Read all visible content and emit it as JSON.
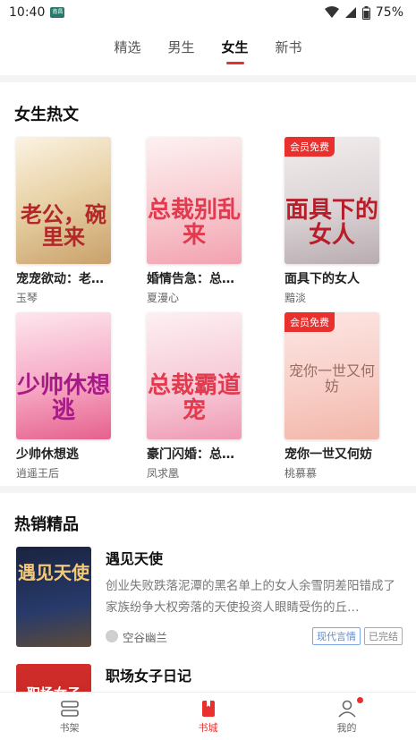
{
  "status": {
    "time": "10:40",
    "sim_label": "南昌",
    "battery": "75%"
  },
  "top_tabs": [
    {
      "label": "精选",
      "active": false
    },
    {
      "label": "男生",
      "active": false
    },
    {
      "label": "女生",
      "active": true
    },
    {
      "label": "新书",
      "active": false
    }
  ],
  "hot_section": {
    "title": "女生热文",
    "books": [
      {
        "cover_text": "老公，碗里来",
        "name": "宠宠欲动：老…",
        "author": "玉琴",
        "vip": ""
      },
      {
        "cover_text": "总裁别乱来",
        "name": "婚情告急：总…",
        "author": "夏漫心",
        "vip": ""
      },
      {
        "cover_text": "面具下的女人",
        "name": "面具下的女人",
        "author": "黯淡",
        "vip": "会员免费"
      },
      {
        "cover_text": "少帅休想逃",
        "name": "少帅休想逃",
        "author": "逍遥王后",
        "vip": ""
      },
      {
        "cover_text": "总裁霸道宠",
        "name": "豪门闪婚：总…",
        "author": "凤求凰",
        "vip": ""
      },
      {
        "cover_text": "宠你一世又何妨",
        "name": "宠你一世又何妨",
        "author": "桃慕慕",
        "vip": "会员免费"
      }
    ]
  },
  "best_section": {
    "title": "热销精品",
    "items": [
      {
        "cover_text": "遇见天使",
        "title": "遇见天使",
        "desc": "创业失败跌落泥潭的黑名单上的女人余雪阴差阳错成了家族纷争大权旁落的天使投资人眼睛受伤的丘…",
        "author": "空谷幽兰",
        "tags": [
          "现代言情",
          "已完结"
        ]
      },
      {
        "cover_text": "职场女子",
        "title": "职场女子日记",
        "desc": "",
        "author": "",
        "tags": []
      }
    ]
  },
  "bottom_nav": [
    {
      "label": "书架",
      "active": false
    },
    {
      "label": "书城",
      "active": true
    },
    {
      "label": "我的",
      "active": false
    }
  ],
  "colors": {
    "accent": "#e8312f",
    "tag_blue": "#5b8dd6"
  }
}
